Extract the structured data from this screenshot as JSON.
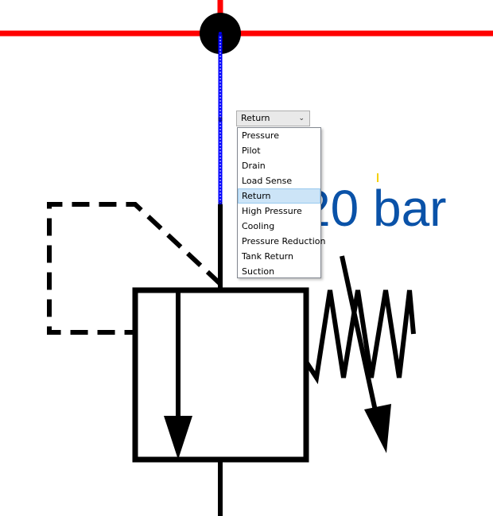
{
  "diagram": {
    "pressure_label": "20 bar",
    "colors": {
      "supply_line": "#ff0000",
      "selected_line": "#0000ff",
      "symbol": "#000000",
      "label": "#0a52a8"
    }
  },
  "line_type_dropdown": {
    "selected": "Return",
    "options": [
      "Pressure",
      "Pilot",
      "Drain",
      "Load Sense",
      "Return",
      "High Pressure",
      "Cooling",
      "Pressure Reduction",
      "Tank Return",
      "Suction"
    ],
    "chevron_icon": "chevron-down-icon"
  }
}
